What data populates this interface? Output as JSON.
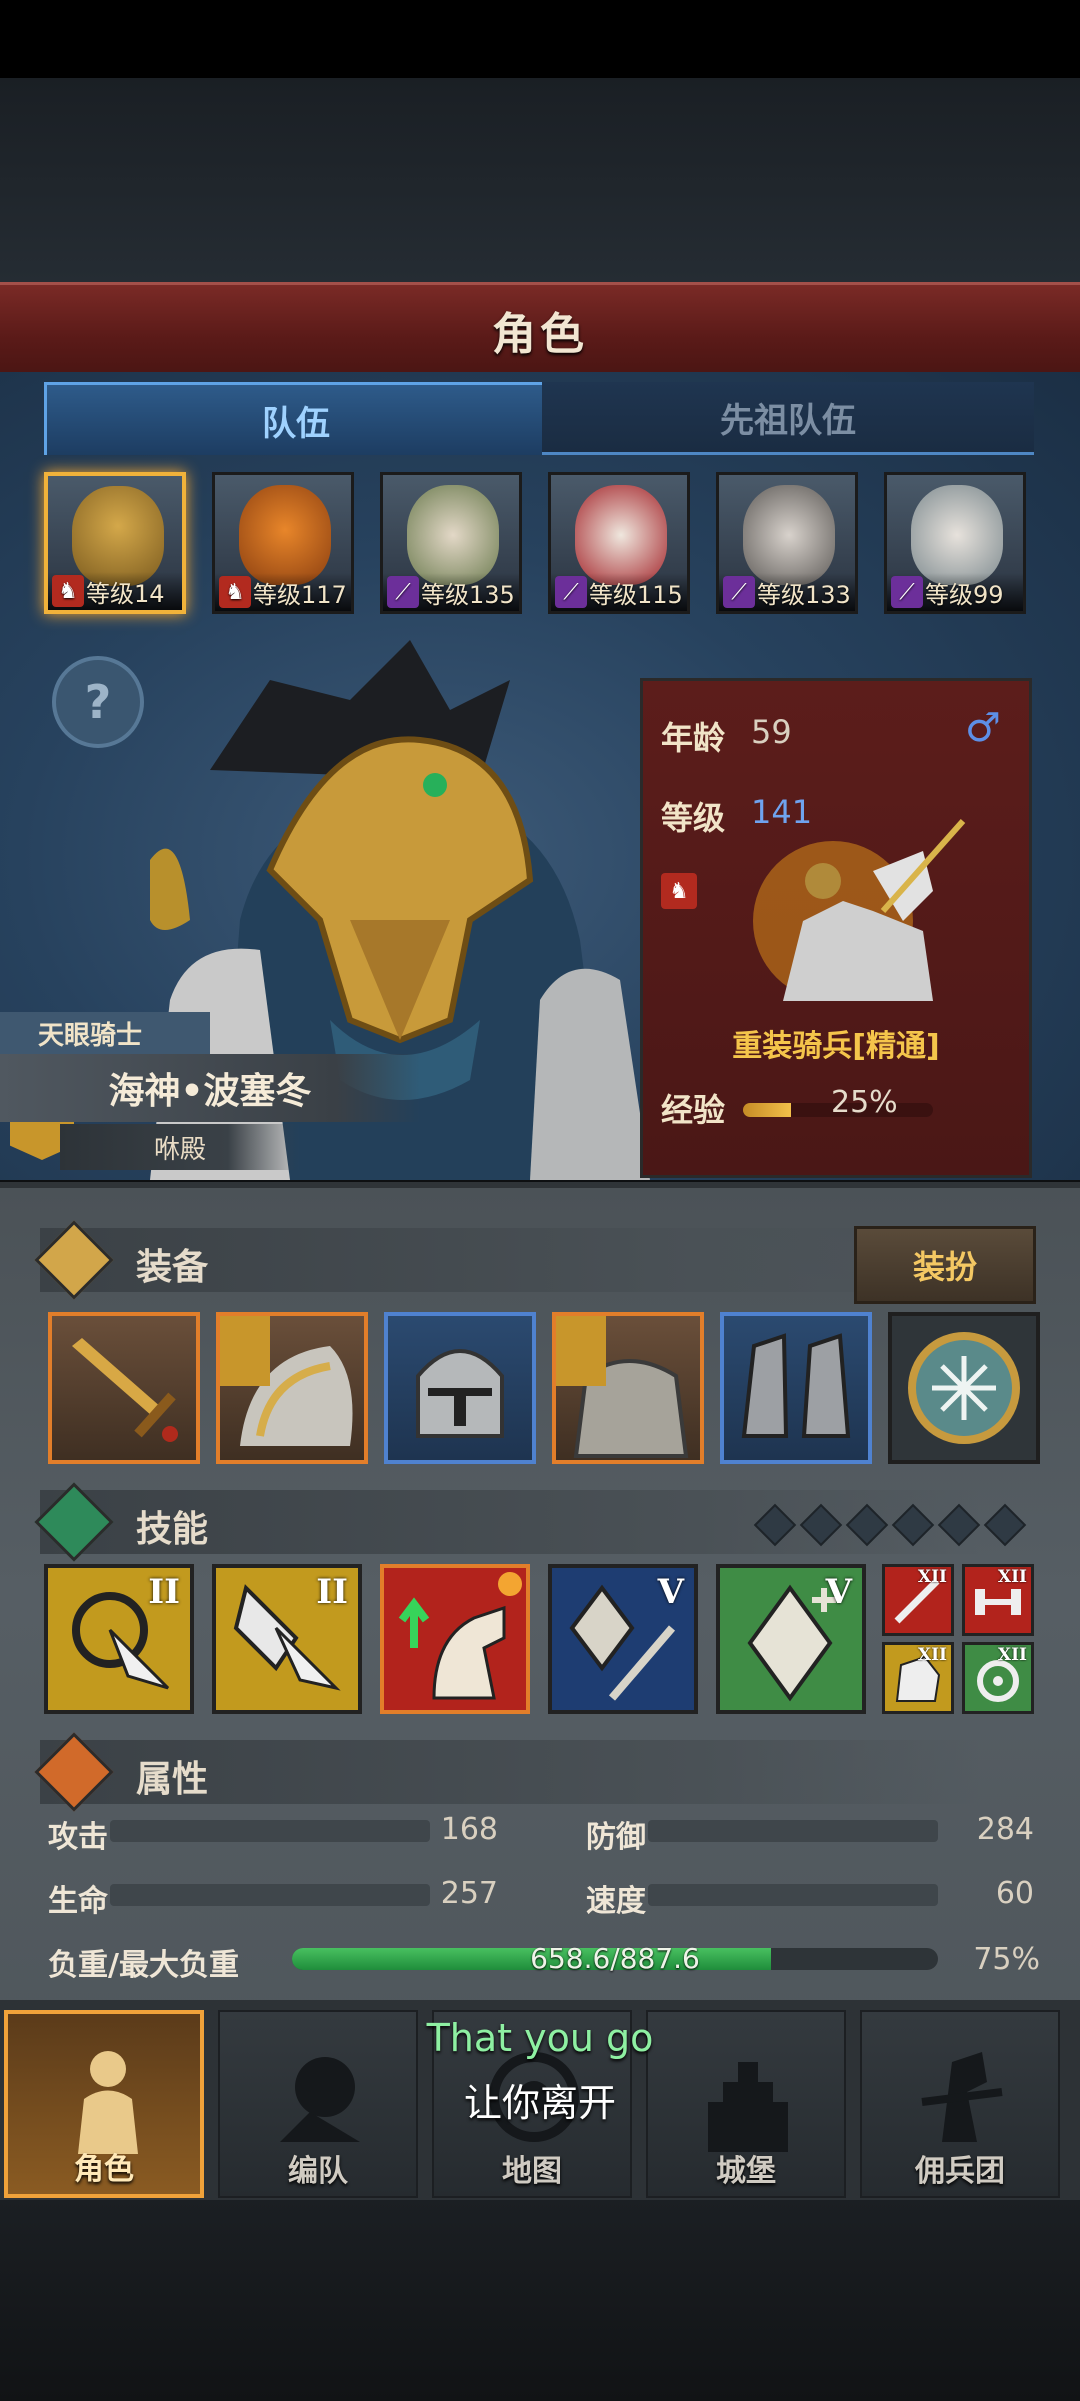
{
  "screen": {
    "title": "角色"
  },
  "tabs": [
    {
      "label": "队伍",
      "active": true
    },
    {
      "label": "先祖队伍",
      "active": false
    }
  ],
  "party": [
    {
      "level_text": "等级14",
      "class_badge": "horse-icon",
      "badge_color": "#b22a1f",
      "selected": true
    },
    {
      "level_text": "等级117",
      "class_badge": "horse-icon",
      "badge_color": "#b22a1f",
      "selected": false
    },
    {
      "level_text": "等级135",
      "class_badge": "staff-icon",
      "badge_color": "#6c2f9a",
      "selected": false
    },
    {
      "level_text": "等级115",
      "class_badge": "staff-icon",
      "badge_color": "#6c2f9a",
      "selected": false
    },
    {
      "level_text": "等级133",
      "class_badge": "staff-icon",
      "badge_color": "#6c2f9a",
      "selected": false
    },
    {
      "level_text": "等级99",
      "class_badge": "staff-icon",
      "badge_color": "#6c2f9a",
      "selected": false
    }
  ],
  "hero": {
    "class_label": "天眼骑士",
    "name": "海神•波塞冬",
    "title": "咻殿"
  },
  "info": {
    "age_label": "年龄",
    "age": "59",
    "level_label": "等级",
    "level": "141",
    "gender_icon": "male-icon",
    "unit_name": "重装骑兵[精通]",
    "exp_label": "经验",
    "exp_percent_text": "25%",
    "exp_fraction": 0.25
  },
  "equipment": {
    "title": "装备",
    "dress_button": "装扮",
    "slots": [
      {
        "item": "sword-icon",
        "rarity": "orange"
      },
      {
        "item": "pauldron-icon",
        "rarity": "orange"
      },
      {
        "item": "helmet-icon",
        "rarity": "blue"
      },
      {
        "item": "armor-icon",
        "rarity": "orange"
      },
      {
        "item": "boots-icon",
        "rarity": "blue"
      },
      {
        "item": "amulet-icon",
        "rarity": "plain"
      }
    ]
  },
  "skills": {
    "title": "技能",
    "slots_indicator_count": 6,
    "main": [
      {
        "icon": "target-cursor-icon",
        "rank": "II",
        "color": "yellow"
      },
      {
        "icon": "pierce-cursor-icon",
        "rank": "II",
        "color": "yellow"
      },
      {
        "icon": "horse-up-icon",
        "rank": "",
        "color": "red"
      },
      {
        "icon": "crystal-sword-icon",
        "rank": "V",
        "color": "blue"
      },
      {
        "icon": "crystal-plus-icon",
        "rank": "V",
        "color": "green"
      }
    ],
    "mini": [
      {
        "icon": "sword-icon",
        "rank": "XII",
        "color": "red"
      },
      {
        "icon": "dumbbell-icon",
        "rank": "XII",
        "color": "red"
      },
      {
        "icon": "armor-icon",
        "rank": "XII",
        "color": "yellow"
      },
      {
        "icon": "target-icon",
        "rank": "XII",
        "color": "green"
      }
    ]
  },
  "attributes": {
    "title": "属性",
    "attack_label": "攻击",
    "attack": "168",
    "defense_label": "防御",
    "defense": "284",
    "hp_label": "生命",
    "hp": "257",
    "speed_label": "速度",
    "speed": "60",
    "load_label": "负重/最大负重",
    "load_text": "658.6/887.6",
    "load_percent_text": "75%",
    "load_fraction": 0.742
  },
  "nav": [
    {
      "label": "角色",
      "icon": "knight-icon",
      "active": true
    },
    {
      "label": "编队",
      "icon": "formation-icon",
      "active": false
    },
    {
      "label": "地图",
      "icon": "map-icon",
      "active": false
    },
    {
      "label": "城堡",
      "icon": "castle-icon",
      "active": false
    },
    {
      "label": "佣兵团",
      "icon": "mercenary-icon",
      "active": false
    }
  ],
  "subtitles": {
    "en": "That you go",
    "zh": "让你离开"
  }
}
